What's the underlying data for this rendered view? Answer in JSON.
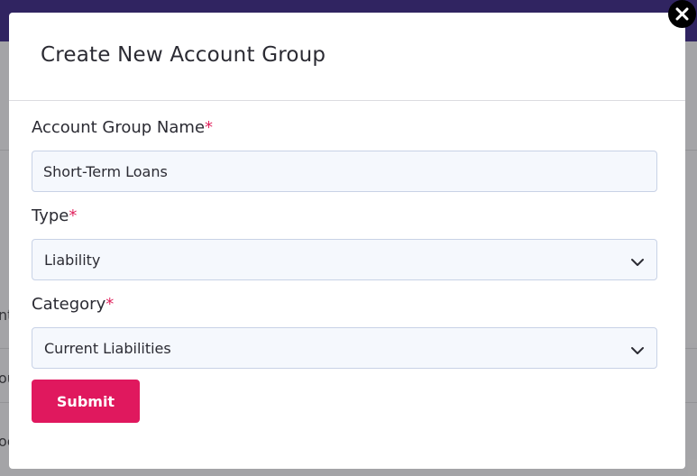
{
  "background": {
    "partial_text_1": "nt",
    "partial_text_2": "ou",
    "partial_text_3": "oc"
  },
  "modal": {
    "title": "Create New Account Group",
    "close_icon": "close-icon",
    "fields": {
      "name": {
        "label": "Account Group Name",
        "required_mark": "*",
        "value": "Short-Term Loans"
      },
      "type": {
        "label": "Type",
        "required_mark": "*",
        "selected": "Liability"
      },
      "category": {
        "label": "Category",
        "required_mark": "*",
        "selected": "Current Liabilities"
      }
    },
    "submit_label": "Submit"
  },
  "colors": {
    "accent": "#e0185e",
    "topbar": "#3b2c77",
    "required": "#e0245e"
  }
}
